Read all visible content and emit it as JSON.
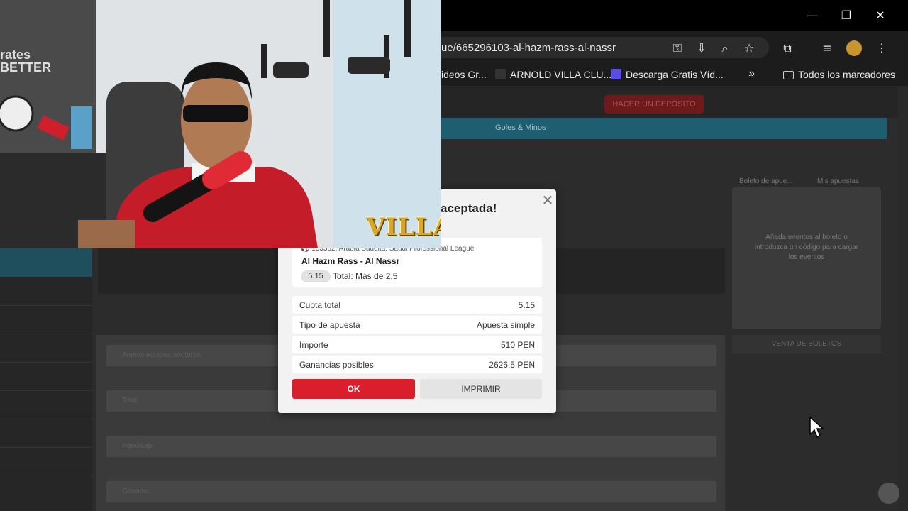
{
  "browser": {
    "url": "ue/665296103-al-hazm-rass-al-nassr",
    "window_controls": {
      "minimize": "—",
      "restore": "❐",
      "close": "✕"
    },
    "bookmarks": [
      {
        "label": "ideos Gr...",
        "icon": "none"
      },
      {
        "label": "ARNOLD VILLA CLU...",
        "icon": "favicon-icon"
      },
      {
        "label": "Descarga Gratis Víd...",
        "icon": "play-icon"
      },
      {
        "label": "»",
        "icon": "overflow"
      },
      {
        "label": "Todos los marcadores",
        "icon": "folder-icon"
      }
    ]
  },
  "site": {
    "deposit_label": "HACER UN DEPÓSITO",
    "blue_bar_text": "Goles & Minos",
    "right_tabs": [
      "Boleto de apue...",
      "Mis apuestas"
    ],
    "right_text": "Añada eventos al boleto o introduzca un código para cargar los eventos",
    "ticket_button": "VENTA DE BOLETOS",
    "market_rows": [
      "Ambos equipos anotarán",
      "Total",
      "Hándicap",
      "Ganador"
    ]
  },
  "modal": {
    "title": "aceptada!",
    "close_glyph": "✕",
    "event": {
      "league": "153382. Arabia Saudita. Saudi Professional League",
      "match": "Al Hazm Rass - Al Nassr",
      "odds": "5.15",
      "pick": "Total: Más de 2.5"
    },
    "rows": [
      {
        "label": "Cuota total",
        "value": "5.15"
      },
      {
        "label": "Tipo de apuesta",
        "value": "Apuesta simple"
      },
      {
        "label": "Importe",
        "value": "510 PEN"
      },
      {
        "label": "Ganancias posibles",
        "value": "2626.5 PEN"
      }
    ],
    "ok_label": "OK",
    "print_label": "IMPRIMIR"
  },
  "webcam": {
    "brand": "VILLA",
    "wall_text": "rates BETTER"
  },
  "colors": {
    "accent_red": "#d91f2b",
    "blue_bar": "#1f5e70",
    "brand_gold": "#d7a82c"
  }
}
